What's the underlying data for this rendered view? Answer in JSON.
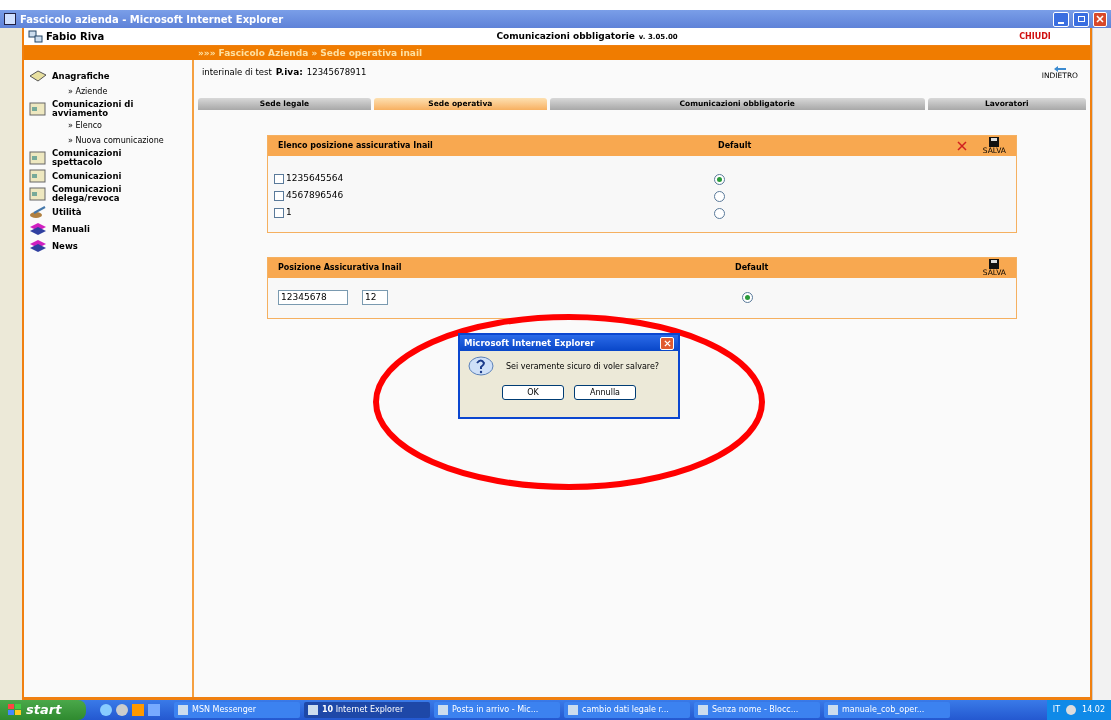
{
  "window": {
    "title": "Fascicolo azienda - Microsoft Internet Explorer"
  },
  "header": {
    "user": "Fabio Riva",
    "app_title": "Comunicazioni obbligatorie",
    "version": "v. 3.05.00",
    "close": "CHIUDI"
  },
  "breadcrumb": "»»» Fascicolo Azienda » Sede operativa inail",
  "sidebar": {
    "items": [
      {
        "label": "Anagrafiche",
        "kind": "book",
        "children": [
          {
            "label": "» Aziende"
          }
        ]
      },
      {
        "label": "Comunicazioni di avviamento",
        "kind": "doc",
        "children": [
          {
            "label": "» Elenco"
          },
          {
            "label": "» Nuova comunicazione"
          }
        ]
      },
      {
        "label": "Comunicazioni spettacolo",
        "kind": "doc"
      },
      {
        "label": "Comunicazioni",
        "kind": "doc"
      },
      {
        "label": "Comunicazioni delega/revoca",
        "kind": "doc"
      },
      {
        "label": "Utilità",
        "kind": "tool"
      },
      {
        "label": "Manuali",
        "kind": "books"
      },
      {
        "label": "News",
        "kind": "books"
      }
    ]
  },
  "company": {
    "name": "interinale di test",
    "piva_label": "P.iva:",
    "piva": "12345678911"
  },
  "back": "INDIETRO",
  "tabs": [
    {
      "label": "Sede legale",
      "selected": false
    },
    {
      "label": "Sede operativa",
      "selected": true
    },
    {
      "label": "Comunicazioni obbligatorie",
      "selected": false
    },
    {
      "label": "Lavoratori",
      "selected": false
    }
  ],
  "list_panel": {
    "title": "Elenco posizione assicurativa Inail",
    "default_header": "Default",
    "save": "SALVA",
    "rows": [
      {
        "code": "1235645564",
        "checked": false,
        "selected": true
      },
      {
        "code": "4567896546",
        "checked": false,
        "selected": false
      },
      {
        "code": "1",
        "checked": false,
        "selected": false
      }
    ]
  },
  "edit_panel": {
    "title": "Posizione Assicurativa Inail",
    "default_header": "Default",
    "save": "SALVA",
    "fields": [
      "12345678",
      "12"
    ],
    "selected": true
  },
  "dialog": {
    "title": "Microsoft Internet Explorer",
    "message": "Sei veramente sicuro di voler salvare?",
    "buttons": [
      "OK",
      "Annulla"
    ]
  },
  "taskbar": {
    "start": "start",
    "items": [
      {
        "label": "MSN Messenger",
        "active": false
      },
      {
        "label": "**10** Internet Explorer",
        "active": true
      },
      {
        "label": "Posta in arrivo - Mic...",
        "active": false
      },
      {
        "label": "cambio dati legale r...",
        "active": false
      },
      {
        "label": "Senza nome - Blocc...",
        "active": false
      },
      {
        "label": "manuale_cob_oper...",
        "active": false
      }
    ],
    "language": "IT",
    "clock": "14.02"
  }
}
